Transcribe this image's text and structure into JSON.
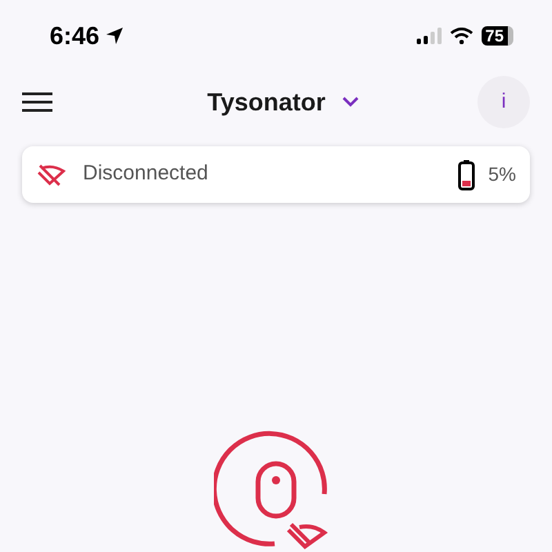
{
  "status_bar": {
    "time": "6:46",
    "battery": "75"
  },
  "header": {
    "title": "Tysonator",
    "info": "i"
  },
  "connection": {
    "status": "Disconnected",
    "connected": false,
    "battery": {
      "reading": "5%"
    }
  }
}
